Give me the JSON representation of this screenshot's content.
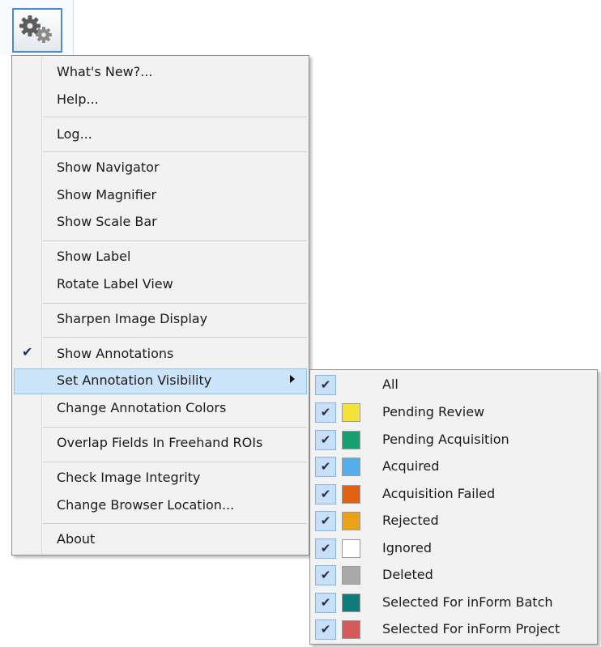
{
  "toolbar": {
    "settings_icon": "gears-icon"
  },
  "menu": {
    "items": [
      {
        "label": "What's New?..."
      },
      {
        "label": "Help..."
      },
      {
        "label": "Log..."
      },
      {
        "label": "Show Navigator"
      },
      {
        "label": "Show Magnifier"
      },
      {
        "label": "Show Scale Bar"
      },
      {
        "label": "Show Label"
      },
      {
        "label": "Rotate Label View"
      },
      {
        "label": "Sharpen Image Display"
      },
      {
        "label": "Show Annotations",
        "checked": true
      },
      {
        "label": "Set Annotation Visibility",
        "submenu": true,
        "highlighted": true
      },
      {
        "label": "Change Annotation Colors"
      },
      {
        "label": "Overlap Fields In Freehand ROIs"
      },
      {
        "label": "Check Image Integrity"
      },
      {
        "label": "Change Browser Location..."
      },
      {
        "label": "About"
      }
    ],
    "check_glyph": "✔"
  },
  "submenu": {
    "items": [
      {
        "label": "All",
        "checked": true,
        "color": null
      },
      {
        "label": "Pending Review",
        "checked": true,
        "color": "#f2e23a"
      },
      {
        "label": "Pending Acquisition",
        "checked": true,
        "color": "#16a071"
      },
      {
        "label": "Acquired",
        "checked": true,
        "color": "#55aeea"
      },
      {
        "label": "Acquisition Failed",
        "checked": true,
        "color": "#df6212"
      },
      {
        "label": "Rejected",
        "checked": true,
        "color": "#eaa318"
      },
      {
        "label": "Ignored",
        "checked": true,
        "color": "#ffffff"
      },
      {
        "label": "Deleted",
        "checked": true,
        "color": "#a9a9a9"
      },
      {
        "label": "Selected For inForm Batch",
        "checked": true,
        "color": "#0f7b7b"
      },
      {
        "label": "Selected For inForm Project",
        "checked": true,
        "color": "#d65a5a"
      }
    ],
    "check_glyph": "✔"
  }
}
